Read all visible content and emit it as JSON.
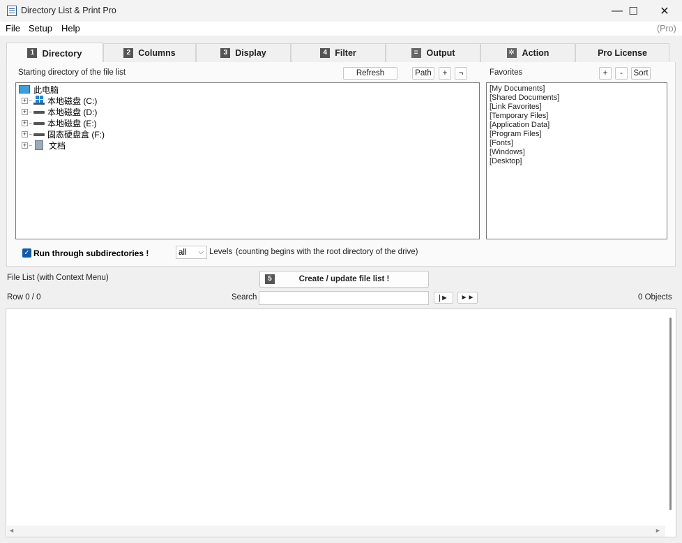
{
  "window": {
    "title": "Directory List & Print Pro",
    "minimize": "—",
    "maximize": "☐",
    "close": "✕"
  },
  "menu": {
    "items": [
      "File",
      "Setup",
      "Help"
    ],
    "pro_label": "(Pro)"
  },
  "tabs": [
    {
      "num": "1",
      "label": "Directory"
    },
    {
      "num": "2",
      "label": "Columns"
    },
    {
      "num": "3",
      "label": "Display"
    },
    {
      "num": "4",
      "label": "Filter"
    },
    {
      "num": "",
      "label": "Output",
      "icon": "doc-icon"
    },
    {
      "num": "",
      "label": "Action",
      "icon": "gear-icon"
    },
    {
      "num": "",
      "label": "Pro License"
    }
  ],
  "directory": {
    "start_label": "Starting directory of the file list",
    "refresh": "Refresh",
    "path": "Path",
    "plus": "+",
    "not": "¬",
    "tree": [
      {
        "label": "此电脑",
        "icon": "computer-icon",
        "level": 0
      },
      {
        "label": "本地磁盘 (C:)",
        "icon": "windows-drive-icon",
        "level": 1
      },
      {
        "label": "本地磁盘 (D:)",
        "icon": "drive-icon",
        "level": 1
      },
      {
        "label": "本地磁盘 (E:)",
        "icon": "drive-icon",
        "level": 1
      },
      {
        "label": "固态硬盘盒 (F:)",
        "icon": "drive-icon",
        "level": 1
      },
      {
        "label": "文档",
        "icon": "documents-icon",
        "level": 1
      }
    ],
    "expander": "+",
    "run_subdirs_label": "Run through subdirectories !",
    "run_subdirs_checked": "✓",
    "levels_value": "all",
    "levels_label": "Levels",
    "levels_note": "(counting begins with the root directory of the drive)"
  },
  "favorites": {
    "label": "Favorites",
    "plus": "+",
    "minus": "-",
    "sort": "Sort",
    "items": [
      "[My Documents]",
      "[Shared Documents]",
      "[Link Favorites]",
      "[Temporary Files]",
      "[Application Data]",
      "[Program Files]",
      "[Fonts]",
      "[Windows]",
      "[Desktop]"
    ]
  },
  "filelist": {
    "label": "File List (with Context Menu)",
    "create_num": "5",
    "create_label": "Create / update file list !",
    "row_label": "Row 0 / 0",
    "search_label": "Search",
    "search_value": "",
    "next_btn": "|►",
    "ff_btn": "►►",
    "objects": "0 Objects"
  },
  "scroll": {
    "left": "◄",
    "right": "►"
  }
}
